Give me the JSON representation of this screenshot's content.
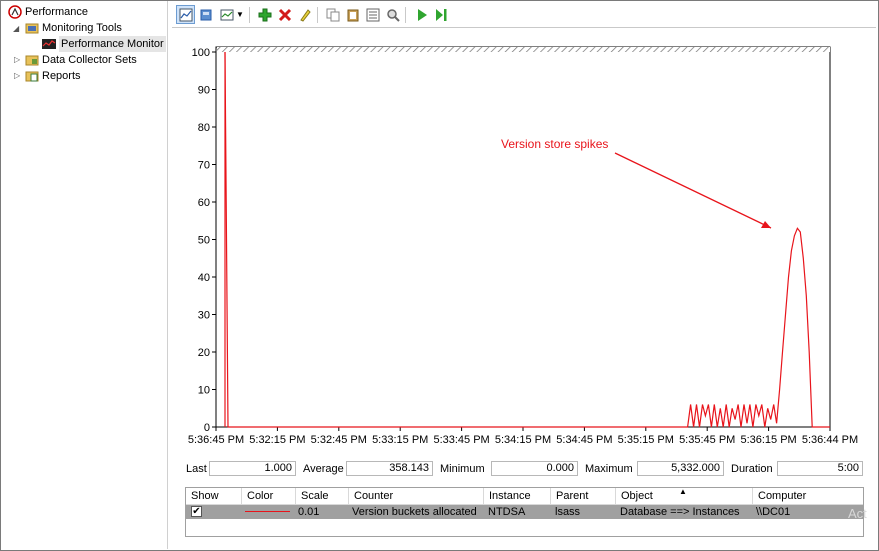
{
  "tree": {
    "root": "Performance",
    "monitoring_tools": "Monitoring Tools",
    "performance_monitor": "Performance Monitor",
    "data_collector_sets": "Data Collector Sets",
    "reports": "Reports"
  },
  "toolbar": {
    "icons": [
      "graph-view-icon",
      "freeze-display-icon",
      "change-graph-type-icon",
      "dropdown-arrow-icon",
      "add-counter-icon",
      "delete-counter-icon",
      "highlight-icon",
      "copy-properties-icon",
      "paste-counter-list-icon",
      "properties-icon",
      "zoom-icon",
      "update-data-icon",
      "play-icon",
      "step-icon"
    ]
  },
  "chart_data": {
    "type": "line",
    "y_ticks": [
      "100",
      "90",
      "80",
      "70",
      "60",
      "50",
      "40",
      "30",
      "20",
      "10",
      "0"
    ],
    "ylim": [
      0,
      100
    ],
    "x_ticks": [
      "5:36:45 PM",
      "5:32:15 PM",
      "5:32:45 PM",
      "5:33:15 PM",
      "5:33:45 PM",
      "5:34:15 PM",
      "5:34:45 PM",
      "5:35:15 PM",
      "5:35:45 PM",
      "5:36:15 PM",
      "5:36:44 PM"
    ],
    "series": [
      {
        "color": "#e8141b",
        "values": [
          100,
          0,
          0,
          0,
          0,
          0,
          0,
          0,
          0,
          0,
          0,
          0,
          0,
          0,
          0,
          0,
          0,
          0,
          0,
          0,
          0,
          0,
          0,
          0,
          0,
          0,
          0,
          0,
          0,
          0,
          0,
          0,
          0,
          0,
          0,
          0,
          0,
          0,
          0,
          0,
          0,
          0,
          0,
          0,
          0,
          0,
          0,
          0,
          0,
          0,
          0,
          0,
          0,
          0,
          0,
          0,
          0,
          0,
          0,
          0,
          0,
          0,
          0,
          0,
          0,
          0,
          0,
          0,
          0,
          0,
          0,
          0,
          0,
          0,
          0,
          0,
          0,
          0,
          0,
          0,
          0,
          0,
          0,
          0,
          0,
          0,
          0,
          0,
          0,
          0,
          0,
          0,
          0,
          0,
          0,
          0,
          0,
          0,
          0,
          0,
          0,
          0,
          0,
          0,
          0,
          0,
          0,
          0,
          0,
          0,
          0,
          0,
          0,
          0,
          0,
          0,
          0,
          0,
          0,
          0,
          0,
          0,
          0,
          0,
          0,
          0,
          0,
          0,
          0,
          0,
          0,
          0,
          0,
          0,
          0,
          0,
          0,
          0,
          0,
          0,
          0,
          0,
          0,
          0,
          0,
          0,
          0,
          0,
          0,
          0,
          0,
          0,
          0,
          0,
          0,
          0,
          0,
          6,
          0,
          6,
          0,
          6,
          3,
          6,
          0,
          6,
          0,
          5,
          0,
          6,
          0,
          5,
          2,
          6,
          0,
          6,
          1,
          6,
          0,
          6,
          3,
          6,
          0,
          5,
          2,
          6,
          1,
          10,
          20,
          30,
          40,
          47,
          51,
          53,
          52,
          45,
          35,
          20,
          0,
          0,
          0,
          0,
          0,
          0,
          0
        ]
      }
    ],
    "annotation": "Version store spikes"
  },
  "stats": {
    "last_label": "Last",
    "last_value": "1.000",
    "average_label": "Average",
    "average_value": "358.143",
    "minimum_label": "Minimum",
    "minimum_value": "0.000",
    "maximum_label": "Maximum",
    "maximum_value": "5,332.000",
    "duration_label": "Duration",
    "duration_value": "5:00"
  },
  "legend": {
    "headers": [
      "Show",
      "Color",
      "Scale",
      "Counter",
      "Instance",
      "Parent",
      "Object",
      "Computer"
    ],
    "sort_indicator": "▲",
    "row": {
      "scale": "0.01",
      "counter": "Version buckets allocated",
      "instance": "NTDSA",
      "parent": "lsass",
      "object": "Database ==> Instances",
      "computer": "\\\\DC01"
    },
    "row_color": "#e8141b"
  },
  "watermark": "Act"
}
